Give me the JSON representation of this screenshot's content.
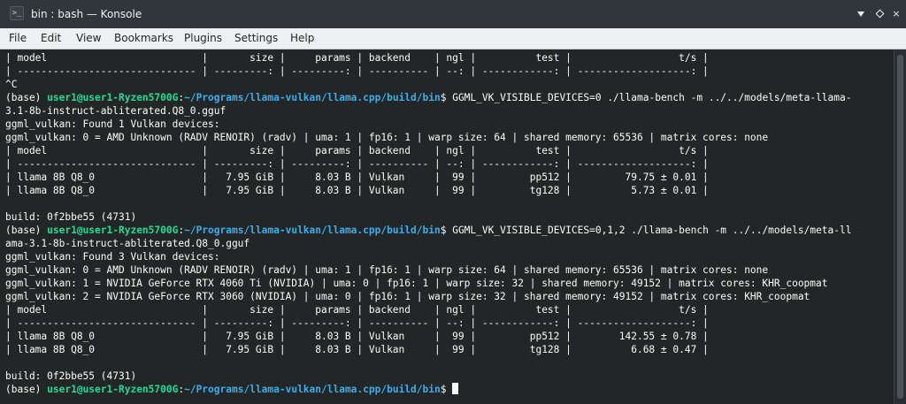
{
  "window": {
    "title": "bin : bash — Konsole",
    "app_icon": "terminal-icon",
    "controls": [
      "minimize-icon",
      "maximize-icon",
      "close-icon"
    ],
    "close_glyph": "×"
  },
  "menubar": {
    "items": [
      "File",
      "Edit",
      "View",
      "Bookmarks",
      "Plugins",
      "Settings",
      "Help"
    ]
  },
  "prompt": {
    "env": "(base) ",
    "user_host": "user1@user1-Ryzen5700G",
    "sep": ":",
    "path": "~/Programs/llama-vulkan/llama.cpp/build/bin",
    "symbol": "$ "
  },
  "lines": [
    "| model                          |       size |     params | backend    | ngl |          test |                  t/s |",
    "| ------------------------------ | ---------: | ---------: | ---------- | --: | ------------: | -------------------: |",
    "^C",
    {
      "cmd": "GGML_VK_VISIBLE_DEVICES=0 ./llama-bench -m ../../models/meta-llama-"
    },
    "3.1-8b-instruct-abliterated.Q8_0.gguf",
    "ggml_vulkan: Found 1 Vulkan devices:",
    "ggml_vulkan: 0 = AMD Unknown (RADV RENOIR) (radv) | uma: 1 | fp16: 1 | warp size: 64 | shared memory: 65536 | matrix cores: none",
    "| model                          |       size |     params | backend    | ngl |          test |                  t/s |",
    "| ------------------------------ | ---------: | ---------: | ---------- | --: | ------------: | -------------------: |",
    "| llama 8B Q8_0                  |   7.95 GiB |     8.03 B | Vulkan     |  99 |         pp512 |         79.75 ± 0.01 |",
    "| llama 8B Q8_0                  |   7.95 GiB |     8.03 B | Vulkan     |  99 |         tg128 |          5.73 ± 0.01 |",
    "",
    "build: 0f2bbe55 (4731)",
    {
      "cmd": "GGML_VK_VISIBLE_DEVICES=0,1,2 ./llama-bench -m ../../models/meta-ll"
    },
    "ama-3.1-8b-instruct-abliterated.Q8_0.gguf",
    "ggml_vulkan: Found 3 Vulkan devices:",
    "ggml_vulkan: 0 = AMD Unknown (RADV RENOIR) (radv) | uma: 1 | fp16: 1 | warp size: 64 | shared memory: 65536 | matrix cores: none",
    "ggml_vulkan: 1 = NVIDIA GeForce RTX 4060 Ti (NVIDIA) | uma: 0 | fp16: 1 | warp size: 32 | shared memory: 49152 | matrix cores: KHR_coopmat",
    "ggml_vulkan: 2 = NVIDIA GeForce RTX 3060 (NVIDIA) | uma: 0 | fp16: 1 | warp size: 32 | shared memory: 49152 | matrix cores: KHR_coopmat",
    "| model                          |       size |     params | backend    | ngl |          test |                  t/s |",
    "| ------------------------------ | ---------: | ---------: | ---------- | --: | ------------: | -------------------: |",
    "| llama 8B Q8_0                  |   7.95 GiB |     8.03 B | Vulkan     |  99 |         pp512 |        142.55 ± 0.78 |",
    "| llama 8B Q8_0                  |   7.95 GiB |     8.03 B | Vulkan     |  99 |         tg128 |          6.68 ± 0.47 |",
    "",
    "build: 0f2bbe55 (4731)",
    {
      "cmd": "",
      "cursor": true
    }
  ],
  "colors": {
    "background": "#232627",
    "foreground": "#fcfcfc",
    "prompt_user": "#1cdc9a",
    "prompt_path": "#3daee9"
  }
}
